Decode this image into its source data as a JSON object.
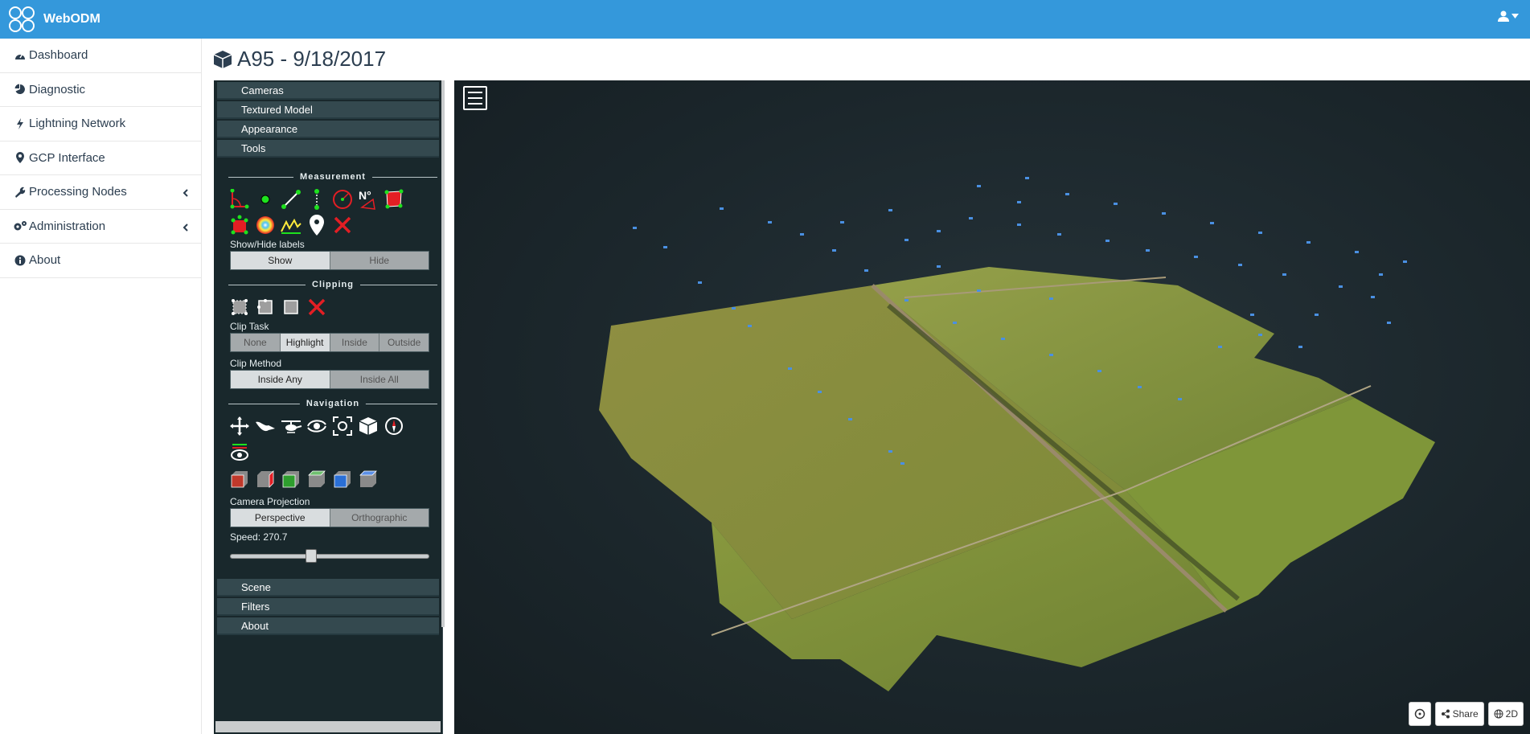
{
  "app": {
    "name": "WebODM"
  },
  "sidebar": {
    "items": [
      {
        "label": "Dashboard",
        "icon": "dashboard-icon"
      },
      {
        "label": "Diagnostic",
        "icon": "pie-chart-icon"
      },
      {
        "label": "Lightning Network",
        "icon": "bolt-icon"
      },
      {
        "label": "GCP Interface",
        "icon": "map-marker-icon"
      },
      {
        "label": "Processing Nodes",
        "icon": "wrench-icon",
        "expandable": true
      },
      {
        "label": "Administration",
        "icon": "cogs-icon",
        "expandable": true
      },
      {
        "label": "About",
        "icon": "info-circle-icon"
      }
    ]
  },
  "page": {
    "title": "A95 - 9/18/2017",
    "title_icon": "cube-icon"
  },
  "potree": {
    "accordion_top": [
      "Cameras",
      "Textured Model",
      "Appearance",
      "Tools"
    ],
    "measurement": {
      "heading": "Measurement",
      "show_hide_label": "Show/Hide labels",
      "show": "Show",
      "hide": "Hide",
      "active": "Show"
    },
    "clipping": {
      "heading": "Clipping",
      "clip_task_label": "Clip Task",
      "clip_task_options": [
        "None",
        "Highlight",
        "Inside",
        "Outside"
      ],
      "clip_task_active": "Highlight",
      "clip_method_label": "Clip Method",
      "clip_method_options": [
        "Inside Any",
        "Inside All"
      ],
      "clip_method_active": "Inside Any"
    },
    "navigation": {
      "heading": "Navigation",
      "camera_projection_label": "Camera Projection",
      "projection_options": [
        "Perspective",
        "Orthographic"
      ],
      "projection_active": "Perspective",
      "speed_label": "Speed: 270.7",
      "speed_fraction": 0.4
    },
    "accordion_bottom": [
      "Scene",
      "Filters",
      "About"
    ]
  },
  "viewer_buttons": {
    "share": "Share",
    "view2d": "2D"
  },
  "colors": {
    "topbar": "#3498db",
    "panel": "#19282c",
    "accordion": "#34494f"
  }
}
